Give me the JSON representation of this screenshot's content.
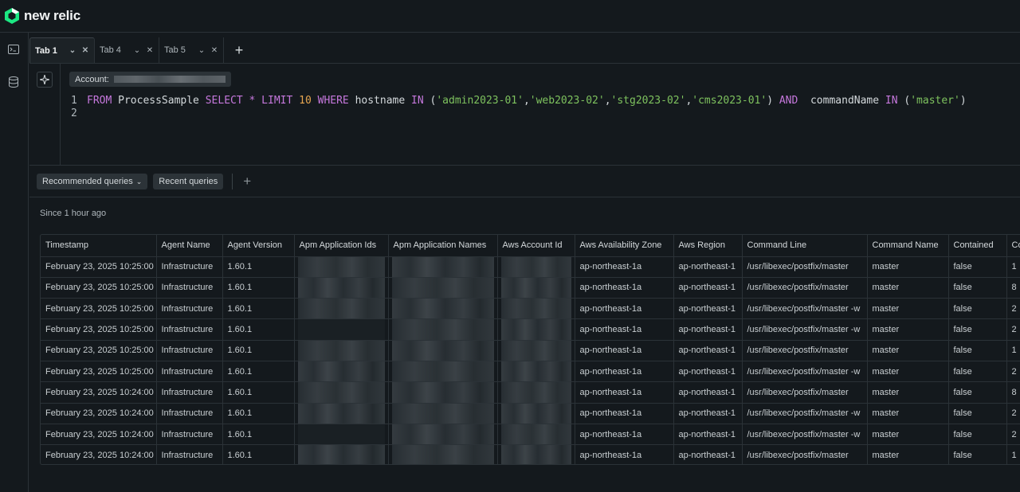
{
  "brand": {
    "name": "new relic"
  },
  "tabs": [
    {
      "label": "Tab 1",
      "active": true
    },
    {
      "label": "Tab 4",
      "active": false
    },
    {
      "label": "Tab 5",
      "active": false
    }
  ],
  "editor": {
    "account_label": "Account:",
    "line_numbers": [
      "1",
      "2"
    ],
    "query_tokens": {
      "from": "FROM",
      "event": "ProcessSample",
      "select": "SELECT",
      "star": "*",
      "limit": "LIMIT",
      "limit_value": "10",
      "where": "WHERE",
      "field1": "hostname",
      "in1": "IN",
      "h1": "'admin2023-01'",
      "h2": "'web2023-02'",
      "h3": "'stg2023-02'",
      "h4": "'cms2023-01'",
      "and": "AND",
      "field2": "commandName",
      "in2": "IN",
      "cmd": "'master'"
    }
  },
  "toolbar": {
    "recommended_label": "Recommended queries",
    "recent_label": "Recent queries"
  },
  "results": {
    "since": "Since 1 hour ago",
    "columns": [
      "Timestamp",
      "Agent Name",
      "Agent Version",
      "Apm Application Ids",
      "Apm Application Names",
      "Aws Account Id",
      "Aws Availability Zone",
      "Aws Region",
      "Command Line",
      "Command Name",
      "Contained",
      "Co"
    ],
    "rows": [
      [
        "February 23, 2025 10:25:00",
        "Infrastructure",
        "1.60.1",
        "",
        "",
        "",
        "ap-northeast-1a",
        "ap-northeast-1",
        "/usr/libexec/postfix/master",
        "master",
        "false",
        "1"
      ],
      [
        "February 23, 2025 10:25:00",
        "Infrastructure",
        "1.60.1",
        "",
        "",
        "",
        "ap-northeast-1a",
        "ap-northeast-1",
        "/usr/libexec/postfix/master",
        "master",
        "false",
        "8"
      ],
      [
        "February 23, 2025 10:25:00",
        "Infrastructure",
        "1.60.1",
        "",
        "",
        "",
        "ap-northeast-1a",
        "ap-northeast-1",
        "/usr/libexec/postfix/master -w",
        "master",
        "false",
        "2"
      ],
      [
        "February 23, 2025 10:25:00",
        "Infrastructure",
        "1.60.1",
        "",
        "",
        "",
        "ap-northeast-1a",
        "ap-northeast-1",
        "/usr/libexec/postfix/master -w",
        "master",
        "false",
        "2"
      ],
      [
        "February 23, 2025 10:25:00",
        "Infrastructure",
        "1.60.1",
        "",
        "",
        "",
        "ap-northeast-1a",
        "ap-northeast-1",
        "/usr/libexec/postfix/master",
        "master",
        "false",
        "1"
      ],
      [
        "February 23, 2025 10:25:00",
        "Infrastructure",
        "1.60.1",
        "",
        "",
        "",
        "ap-northeast-1a",
        "ap-northeast-1",
        "/usr/libexec/postfix/master -w",
        "master",
        "false",
        "2"
      ],
      [
        "February 23, 2025 10:24:00",
        "Infrastructure",
        "1.60.1",
        "",
        "",
        "",
        "ap-northeast-1a",
        "ap-northeast-1",
        "/usr/libexec/postfix/master",
        "master",
        "false",
        "8"
      ],
      [
        "February 23, 2025 10:24:00",
        "Infrastructure",
        "1.60.1",
        "",
        "",
        "",
        "ap-northeast-1a",
        "ap-northeast-1",
        "/usr/libexec/postfix/master -w",
        "master",
        "false",
        "2"
      ],
      [
        "February 23, 2025 10:24:00",
        "Infrastructure",
        "1.60.1",
        "",
        "",
        "",
        "ap-northeast-1a",
        "ap-northeast-1",
        "/usr/libexec/postfix/master -w",
        "master",
        "false",
        "2"
      ],
      [
        "February 23, 2025 10:24:00",
        "Infrastructure",
        "1.60.1",
        "",
        "",
        "",
        "ap-northeast-1a",
        "ap-northeast-1",
        "/usr/libexec/postfix/master",
        "master",
        "false",
        "1"
      ]
    ]
  },
  "colors": {
    "background": "#14191d",
    "keyword": "#c678dd",
    "string": "#7ec25e",
    "number": "#e5a550",
    "logo": "#1ce783"
  }
}
